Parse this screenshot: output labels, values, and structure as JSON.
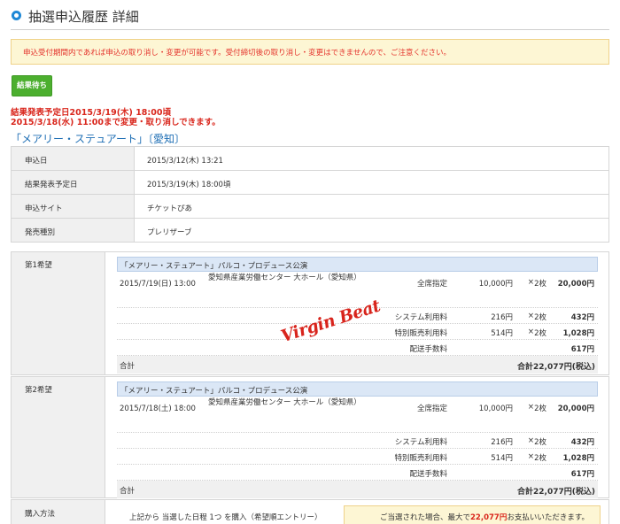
{
  "page": {
    "title": "抽選申込履歴 詳細",
    "notice": "申込受付期間内であれば申込の取り消し・変更が可能です。受付締切後の取り消し・変更はできませんので、ご注意ください。",
    "status_button": "結果待ち",
    "deadline_line1": "結果発表予定日2015/3/19(木) 18:00頃",
    "deadline_line2": "2015/3/18(水) 11:00まで変更・取り消しできます。",
    "event_title": "「メアリー・ステュアート」〔愛知〕"
  },
  "info_rows": [
    {
      "label": "申込日",
      "value": "2015/3/12(木) 13:21"
    },
    {
      "label": "結果発表予定日",
      "value": "2015/3/19(木) 18:00頃"
    },
    {
      "label": "申込サイト",
      "value": "チケットぴあ"
    },
    {
      "label": "発売種別",
      "value": "プレリザーブ"
    }
  ],
  "choices": [
    {
      "label": "第1希望",
      "performance": "「メアリー・ステュアート」パルコ・プロデュース公演",
      "date": "2015/7/19(日) 13:00",
      "venue": "愛知県産業労働センター 大ホール（愛知県）",
      "seat_label": "全席指定",
      "seat_price": "10,000円",
      "seat_qty": "2枚",
      "seat_amount": "20,000円",
      "fees": [
        {
          "label": "システム利用料",
          "price": "216円",
          "qty": "2枚",
          "amount": "432円"
        },
        {
          "label": "特別販売利用料",
          "price": "514円",
          "qty": "2枚",
          "amount": "1,028円"
        },
        {
          "label": "配送手数料",
          "price": "",
          "qty": "",
          "amount": "617円"
        }
      ],
      "total_label": "合計",
      "total_value": "合計22,077円(税込)"
    },
    {
      "label": "第2希望",
      "performance": "「メアリー・ステュアート」パルコ・プロデュース公演",
      "date": "2015/7/18(土) 18:00",
      "venue": "愛知県産業労働センター 大ホール（愛知県）",
      "seat_label": "全席指定",
      "seat_price": "10,000円",
      "seat_qty": "2枚",
      "seat_amount": "20,000円",
      "fees": [
        {
          "label": "システム利用料",
          "price": "216円",
          "qty": "2枚",
          "amount": "432円"
        },
        {
          "label": "特別販売利用料",
          "price": "514円",
          "qty": "2枚",
          "amount": "1,028円"
        },
        {
          "label": "配送手数料",
          "price": "",
          "qty": "",
          "amount": "617円"
        }
      ],
      "total_label": "合計",
      "total_value": "合計22,077円(税込)"
    }
  ],
  "times_symbol": "×",
  "watermark": "Virgin Beat",
  "purchase": {
    "label": "購入方法",
    "text": "上記から 当選した日程 1つ を購入（希望順エントリー）",
    "note_pre": "ご当選された場合、最大で",
    "note_amount": "22,077円",
    "note_post": "お支払いいただきます。"
  },
  "colors": {
    "accent_blue": "#1e88d6",
    "status_green": "#4caf2f",
    "alert_red": "#d9261c",
    "notice_bg": "#fdf6d4"
  }
}
